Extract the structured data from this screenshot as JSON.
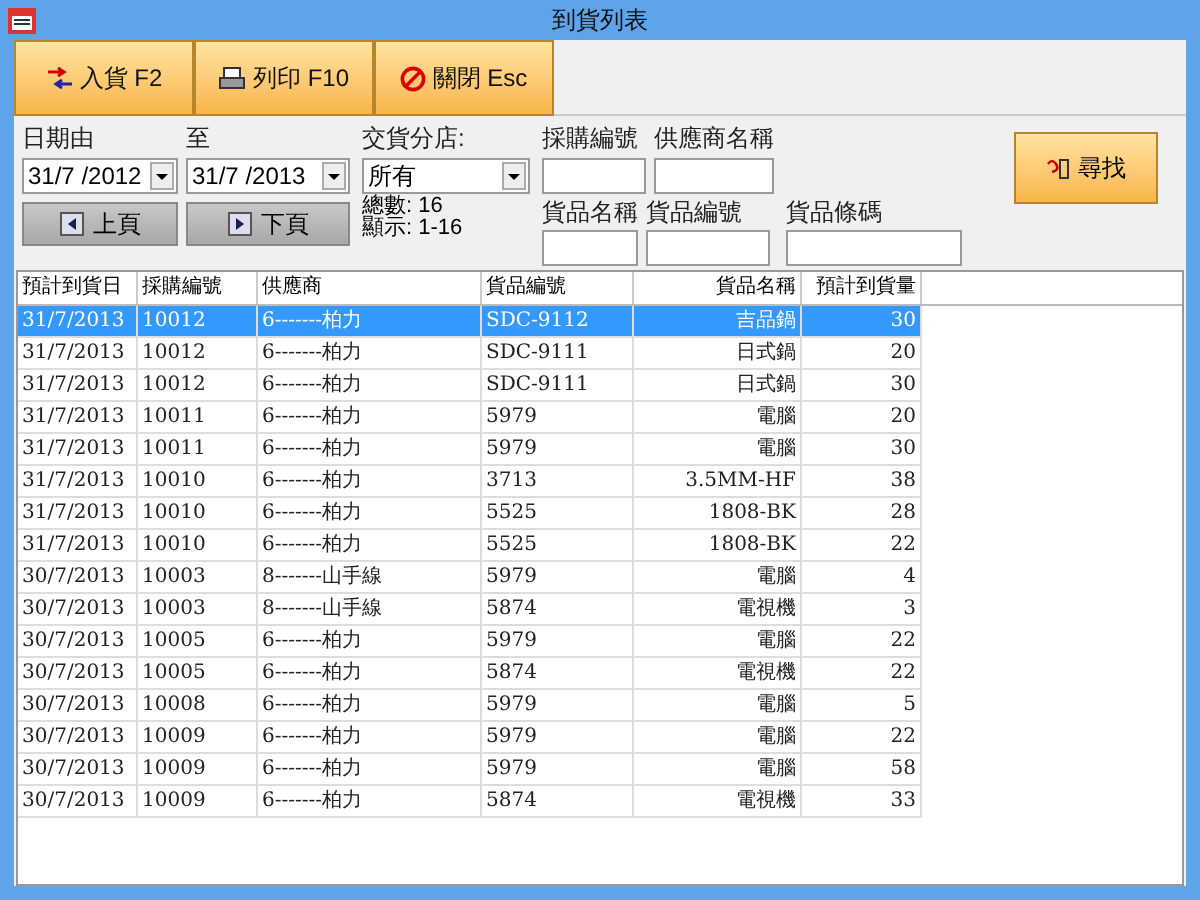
{
  "window": {
    "title": "到貨列表"
  },
  "toolbar": [
    {
      "kind": "receive",
      "label": "入貨 F2"
    },
    {
      "kind": "print",
      "label": "列印 F10"
    },
    {
      "kind": "close",
      "label": "關閉 Esc"
    }
  ],
  "filters": {
    "date_from": {
      "label": "日期由",
      "value": "31/7 /2012"
    },
    "date_to": {
      "label": "至",
      "value": "31/7 /2013"
    },
    "branch": {
      "label": "交貨分店:",
      "value": "所有"
    },
    "po_number": {
      "label": "採購編號"
    },
    "supplier_name": {
      "label": "供應商名稱"
    },
    "product_name": {
      "label": "貨品名稱"
    },
    "product_code": {
      "label": "貨品編號"
    },
    "barcode": {
      "label": "貨品條碼"
    }
  },
  "paging": {
    "prev": "上頁",
    "next": "下頁",
    "total": "總數: 16",
    "showing": "顯示: 1-16"
  },
  "search_button": "尋找",
  "table": {
    "columns": [
      {
        "label": "預計到貨日"
      },
      {
        "label": "採購編號"
      },
      {
        "label": "供應商"
      },
      {
        "label": "貨品編號"
      },
      {
        "label": "貨品名稱"
      },
      {
        "label": "預計到貨量"
      }
    ],
    "rows": [
      {
        "selected": true,
        "cells": [
          "31/7/2013",
          "10012",
          "6-------柏力",
          "SDC-9112",
          "吉品鍋",
          "30"
        ]
      },
      {
        "selected": false,
        "cells": [
          "31/7/2013",
          "10012",
          "6-------柏力",
          "SDC-9111",
          "日式鍋",
          "20"
        ]
      },
      {
        "selected": false,
        "cells": [
          "31/7/2013",
          "10012",
          "6-------柏力",
          "SDC-9111",
          "日式鍋",
          "30"
        ]
      },
      {
        "selected": false,
        "cells": [
          "31/7/2013",
          "10011",
          "6-------柏力",
          "5979",
          "電腦",
          "20"
        ]
      },
      {
        "selected": false,
        "cells": [
          "31/7/2013",
          "10011",
          "6-------柏力",
          "5979",
          "電腦",
          "30"
        ]
      },
      {
        "selected": false,
        "cells": [
          "31/7/2013",
          "10010",
          "6-------柏力",
          "3713",
          "3.5MM-HF",
          "38"
        ]
      },
      {
        "selected": false,
        "cells": [
          "31/7/2013",
          "10010",
          "6-------柏力",
          "5525",
          "1808-BK",
          "28"
        ]
      },
      {
        "selected": false,
        "cells": [
          "31/7/2013",
          "10010",
          "6-------柏力",
          "5525",
          "1808-BK",
          "22"
        ]
      },
      {
        "selected": false,
        "cells": [
          "30/7/2013",
          "10003",
          "8-------山手線",
          "5979",
          "電腦",
          "4"
        ]
      },
      {
        "selected": false,
        "cells": [
          "30/7/2013",
          "10003",
          "8-------山手線",
          "5874",
          "電視機",
          "3"
        ]
      },
      {
        "selected": false,
        "cells": [
          "30/7/2013",
          "10005",
          "6-------柏力",
          "5979",
          "電腦",
          "22"
        ]
      },
      {
        "selected": false,
        "cells": [
          "30/7/2013",
          "10005",
          "6-------柏力",
          "5874",
          "電視機",
          "22"
        ]
      },
      {
        "selected": false,
        "cells": [
          "30/7/2013",
          "10008",
          "6-------柏力",
          "5979",
          "電腦",
          "5"
        ]
      },
      {
        "selected": false,
        "cells": [
          "30/7/2013",
          "10009",
          "6-------柏力",
          "5979",
          "電腦",
          "22"
        ]
      },
      {
        "selected": false,
        "cells": [
          "30/7/2013",
          "10009",
          "6-------柏力",
          "5979",
          "電腦",
          "58"
        ]
      },
      {
        "selected": false,
        "cells": [
          "30/7/2013",
          "10009",
          "6-------柏力",
          "5874",
          "電視機",
          "33"
        ]
      }
    ]
  }
}
